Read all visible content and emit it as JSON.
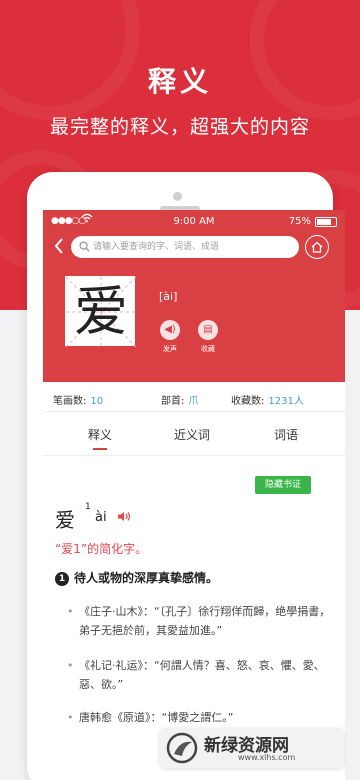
{
  "colors": {
    "hero_red": "#dc2f3c",
    "app_red": "#d94043",
    "accent_blue": "#4aa0c9",
    "accent_green": "#39b54a",
    "pink_red": "#e8454f"
  },
  "hero": {
    "title": "释义",
    "subtitle": "最完整的释义，超强大的内容"
  },
  "status_bar": {
    "time": "9:00 AM",
    "battery": "75%"
  },
  "search": {
    "placeholder": "请输入要查询的字、词语、成语"
  },
  "character": {
    "glyph": "爱",
    "pinyin": "[ài]",
    "actions": [
      {
        "label": "发声",
        "icon": "speaker-icon"
      },
      {
        "label": "收藏",
        "icon": "bookmark-icon"
      }
    ]
  },
  "info": {
    "strokes_label": "笔画数:",
    "strokes_value": "10",
    "radical_label": "部首:",
    "radical_value": "爪",
    "favorites_label": "收藏数:",
    "favorites_value": "1231人"
  },
  "tabs": [
    {
      "label": "释义",
      "active": true
    },
    {
      "label": "近义词",
      "active": false
    },
    {
      "label": "词语",
      "active": false
    }
  ],
  "hide_button": "隐藏书证",
  "entry": {
    "char": "爱",
    "sup": "1",
    "pinyin": "ài",
    "simplified": "“爱1”的简化字。",
    "sense_number": "1",
    "sense_text": "待人或物的深厚真挚感情。",
    "quotes": [
      "《庄子·山木》：“〔孔子〕徐行翔佯而歸，绝學捐書，弟子无挹於前，其愛益加進。”",
      "《礼记·礼运》：“何謂人情？喜、怒、哀、懼、愛、惡、欲。”",
      "唐韩愈《原道》：“博愛之謂仁。”"
    ]
  },
  "watermark": {
    "name": "新绿资源网",
    "url": "www.xlhs.com"
  }
}
